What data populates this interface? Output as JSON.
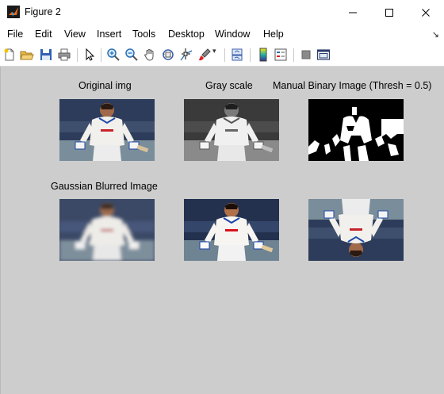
{
  "window": {
    "title": "Figure 2"
  },
  "menu": [
    "File",
    "Edit",
    "View",
    "Insert",
    "Tools",
    "Desktop",
    "Window",
    "Help"
  ],
  "toolbar": {
    "icons": [
      "new-figure-icon",
      "open-file-icon",
      "save-icon",
      "print-icon",
      "edit-plot-arrow-icon",
      "zoom-in-icon",
      "zoom-out-icon",
      "pan-hand-icon",
      "rotate-3d-icon",
      "data-cursor-icon",
      "brush-icon",
      "link-plot-icon",
      "insert-colorbar-icon",
      "insert-legend-icon",
      "hide-plot-tools-icon",
      "show-plot-tools-icon"
    ]
  },
  "subplots": [
    {
      "title": "Original img",
      "image": "color photo of a cricketer in white kit holding a bat"
    },
    {
      "title": "Gray scale",
      "image": "grayscale version of the photo"
    },
    {
      "title": "Manual Binary Image (Thresh = 0.5)",
      "image": "black and white thresholded image"
    },
    {
      "title": "Gaussian Blurred Image",
      "image": "blurred version of the photo"
    },
    {
      "title": "",
      "image": "sharpened version of the photo"
    },
    {
      "title": "",
      "image": "vertically flipped photo"
    }
  ],
  "colors": {
    "canvas": "#cdcdcd",
    "chrome": "#ffffff"
  }
}
